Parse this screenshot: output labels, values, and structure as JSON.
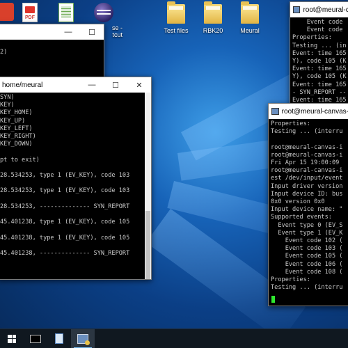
{
  "desktop": {
    "icons": [
      {
        "label": "PDF"
      },
      {
        "label": "se -\ntcut"
      },
      {
        "label": "Test files"
      },
      {
        "label": "RBK20"
      },
      {
        "label": "Meural"
      }
    ]
  },
  "window_back_left": {
    "title": "",
    "lines": [
      "",
      "2)",
      "",
      "",
      "",
      ""
    ]
  },
  "window_main": {
    "title": "home/meural",
    "lines": [
      "SYN)",
      "KEY)",
      "KEY_HOME)",
      "KEY_UP)",
      "KEY_LEFT)",
      "KEY_RIGHT)",
      "KEY_DOWN)",
      "",
      "pt to exit)",
      "",
      "28.534253, type 1 (EV_KEY), code 103",
      "",
      "28.534253, type 1 (EV_KEY), code 103",
      "",
      "28.534253, -------------- SYN_REPORT",
      "",
      "45.401238, type 1 (EV_KEY), code 105",
      "",
      "45.401238, type 1 (EV_KEY), code 105",
      "",
      "45.401238, -------------- SYN_REPORT"
    ]
  },
  "window_top_right": {
    "title": "root@meural-canv",
    "lines": [
      "    Event code",
      "    Event code",
      "Properties:",
      "Testing ... (in",
      "Event: time 165",
      "Y), code 105 (K",
      "Event: time 165",
      "Y), code 105 (K",
      "Event: time 165",
      "- SYN_REPORT --",
      "Event: time 165"
    ]
  },
  "window_front_right": {
    "title": "root@meural-canvas-ii: /h",
    "lines": [
      "Properties:",
      "Testing ... (interru",
      "",
      "root@meural-canvas-i",
      "root@meural-canvas-i",
      "Fri Apr 15 19:00:09",
      "root@meural-canvas-i",
      "est /dev/input/event",
      "Input driver version",
      "Input device ID: bus",
      "0x0 version 0x0",
      "Input device name: \"",
      "Supported events:",
      "  Event type 0 (EV_S",
      "  Event type 1 (EV_K",
      "    Event code 102 (",
      "    Event code 103 (",
      "    Event code 105 (",
      "    Event code 106 (",
      "    Event code 108 (",
      "Properties:",
      "Testing ... (interru"
    ]
  },
  "taskbar": {
    "items": [
      "start-button",
      "terminal-app",
      "notepad-app",
      "putty-app"
    ],
    "active": "putty-app"
  }
}
